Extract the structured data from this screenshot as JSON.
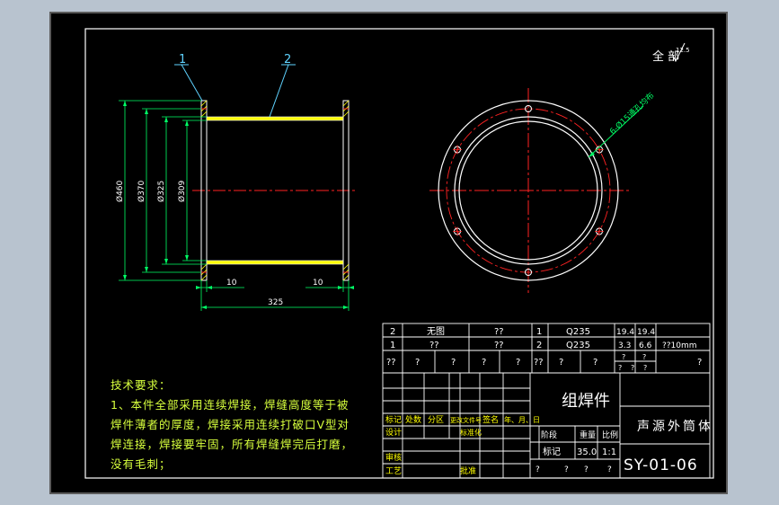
{
  "title_block_note": "全 部",
  "surface_roughness": "12.5",
  "part_labels": [
    "1",
    "2"
  ],
  "hole_callout": "6-Ø15通孔均布",
  "dimensions": {
    "d_outer": "Ø460",
    "d_bolt_circle": "Ø370",
    "d_shell_outer": "Ø325",
    "d_shell_inner": "Ø309",
    "flange_thickness_left": "10",
    "flange_thickness_right": "10",
    "overall_length": "325"
  },
  "bom": [
    {
      "item": "2",
      "name": "无图",
      "qty": "??",
      "index": "1",
      "material": "Q235",
      "w1": "19.4",
      "w2": "19.4",
      "note": ""
    },
    {
      "item": "1",
      "name": "??",
      "qty": "??",
      "index": "2",
      "material": "Q235",
      "w1": "3.3",
      "w2": "6.6",
      "note": "??10mm"
    },
    {
      "item": "??",
      "name": "?",
      "name2": "?",
      "qty": "?",
      "qty2": "?",
      "index": "??",
      "material": "?",
      "material2": "?",
      "w1": "?",
      "w2": "?",
      "note": "?"
    }
  ],
  "bom_sub": [
    "?",
    "?",
    "?"
  ],
  "title_block": {
    "drawing_type": "组焊件",
    "part_name": "声源外筒体",
    "drawing_no": "SY-01-06",
    "scale": "1:1",
    "stage_label": "阶段",
    "weight_label": "重量",
    "ratio_label": "比例",
    "weight_value": "35.0",
    "mark_label": "标记",
    "left_labels": [
      "标记",
      "处数",
      "分区",
      "更改文件号",
      "签名",
      "年、月、日"
    ],
    "row_labels": [
      "设计",
      "标准化",
      "审核",
      "工艺",
      "批准"
    ],
    "bottom_cells": [
      "?",
      "?",
      "?",
      "?"
    ]
  },
  "tech_notes": [
    "技术要求：",
    "1、本件全部采用连续焊接，焊缝高度等于被",
    "焊件薄者的厚度，焊接采用连续打破口V型对",
    "焊连接，焊接要牢固，所有焊缝焊完后打磨，",
    "没有毛刺；"
  ],
  "colors": {
    "background": "#000000",
    "frame": "#ffffff",
    "part_outline": "#ffffff",
    "weld_hatch": "#ffff00",
    "dimension": "#00ff66",
    "centerline": "#ff2222",
    "leader": "#5fd3ff",
    "table_line": "#ffffff",
    "table_text": "#ffffff",
    "notes": "#d7ff3d",
    "viewport": "#b8c3cf"
  }
}
